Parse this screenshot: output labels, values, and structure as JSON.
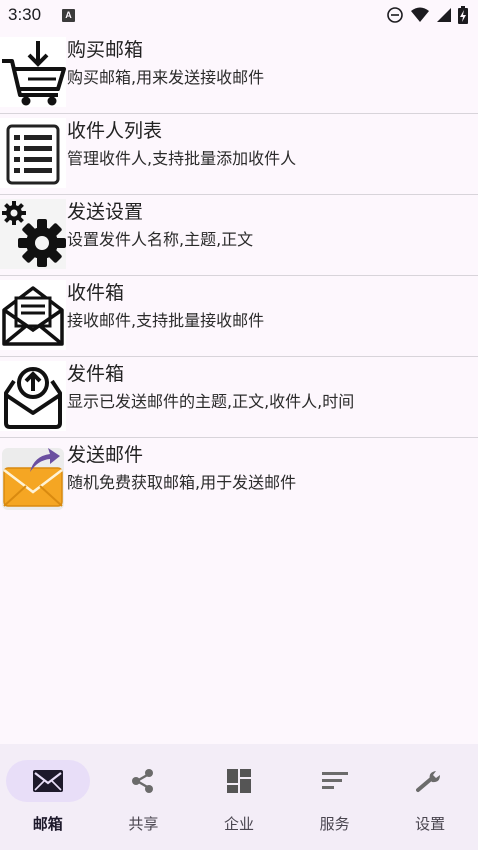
{
  "status_bar": {
    "time": "3:30",
    "notification_badge": "A",
    "icons": [
      "do-not-disturb-icon",
      "wifi-icon",
      "signal-icon",
      "battery-charging-icon"
    ]
  },
  "list": [
    {
      "icon": "shopping-cart-icon",
      "title": "购买邮箱",
      "desc": "购买邮箱,用来发送接收邮件"
    },
    {
      "icon": "list-icon",
      "title": "收件人列表",
      "desc": "管理收件人,支持批量添加收件人"
    },
    {
      "icon": "gears-icon",
      "title": "发送设置",
      "desc": "设置发件人名称,主题,正文"
    },
    {
      "icon": "open-envelope-icon",
      "title": "收件箱",
      "desc": "接收邮件,支持批量接收邮件"
    },
    {
      "icon": "outbox-upload-icon",
      "title": "发件箱",
      "desc": "显示已发送邮件的主题,正文,收件人,时间"
    },
    {
      "icon": "send-mail-icon",
      "title": "发送邮件",
      "desc": "随机免费获取邮箱,用于发送邮件"
    }
  ],
  "bottom_nav": [
    {
      "icon": "mail-icon",
      "label": "邮箱",
      "active": true
    },
    {
      "icon": "share-icon",
      "label": "共享",
      "active": false
    },
    {
      "icon": "dashboard-icon",
      "label": "企业",
      "active": false
    },
    {
      "icon": "sort-icon",
      "label": "服务",
      "active": false
    },
    {
      "icon": "wrench-icon",
      "label": "设置",
      "active": false
    }
  ],
  "colors": {
    "background": "#fdf7fd",
    "nav_background": "#f3edf7",
    "nav_active_pill": "#e8def8",
    "send_mail_icon_orange": "#f5a623",
    "send_mail_icon_purple": "#6b4fa0"
  }
}
